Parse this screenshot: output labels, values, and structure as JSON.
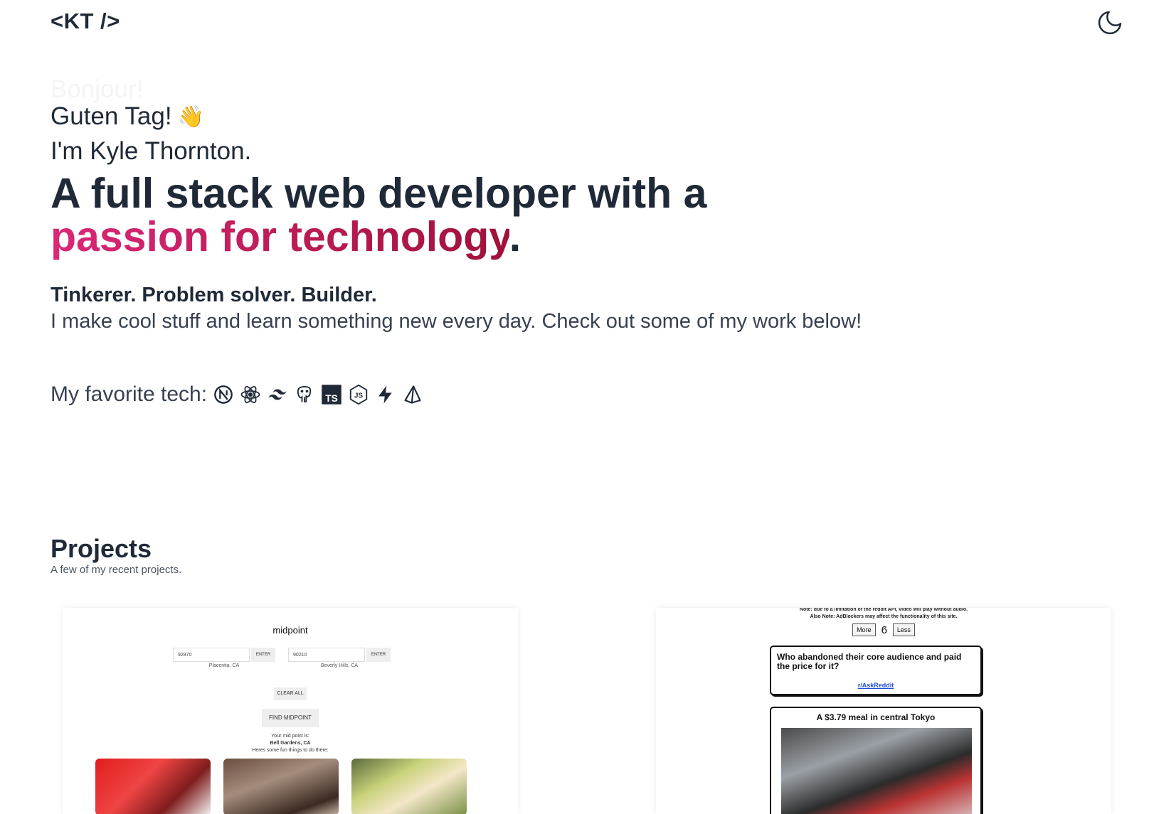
{
  "header": {
    "logo": "<KT />",
    "theme_toggle_icon": "moon-icon"
  },
  "hero": {
    "greeting_faded": "Bonjour!",
    "greeting": "Guten Tag!",
    "greeting_emoji": "👋",
    "intro": "I'm Kyle Thornton.",
    "headline_part1": "A full stack web developer with a",
    "headline_highlight": "passion for technology",
    "headline_end": ".",
    "tagline": "Tinkerer. Problem solver. Builder.",
    "about": "I make cool stuff and learn something new every day. Check out some of my work below!",
    "tech_label": "My favorite tech:",
    "tech_icons": [
      "nextjs-icon",
      "react-icon",
      "tailwind-icon",
      "postgresql-icon",
      "typescript-icon",
      "nodejs-icon",
      "supabase-icon",
      "prisma-icon"
    ]
  },
  "projects": {
    "title": "Projects",
    "subtitle": "A few of my recent projects.",
    "midpoint": {
      "title": "midpoint",
      "zip1_value": "92870",
      "zip1_label": "Placentia, CA",
      "zip2_value": "90210",
      "zip2_label": "Beverly Hills, CA",
      "enter_label": "ENTER",
      "clear_label": "CLEAR ALL",
      "find_label": "FIND MIDPOINT",
      "result_line1": "Your mid point is:",
      "result_city": "Bell Gardens, CA",
      "result_line2": "Heres some fun things to do there:"
    },
    "reddit": {
      "note_line1": "Note: due to a limitation of the reddit API, video will play without audio.",
      "note_line2": "Also Note: AdBlockers may affect the functionality of this site.",
      "more_label": "More",
      "count": "6",
      "less_label": "Less",
      "post1_title": "Who abandoned their core audience and paid the price for it?",
      "post1_sub": "r/AskReddit",
      "post2_title": "A $3.79 meal in central Tokyo"
    }
  }
}
